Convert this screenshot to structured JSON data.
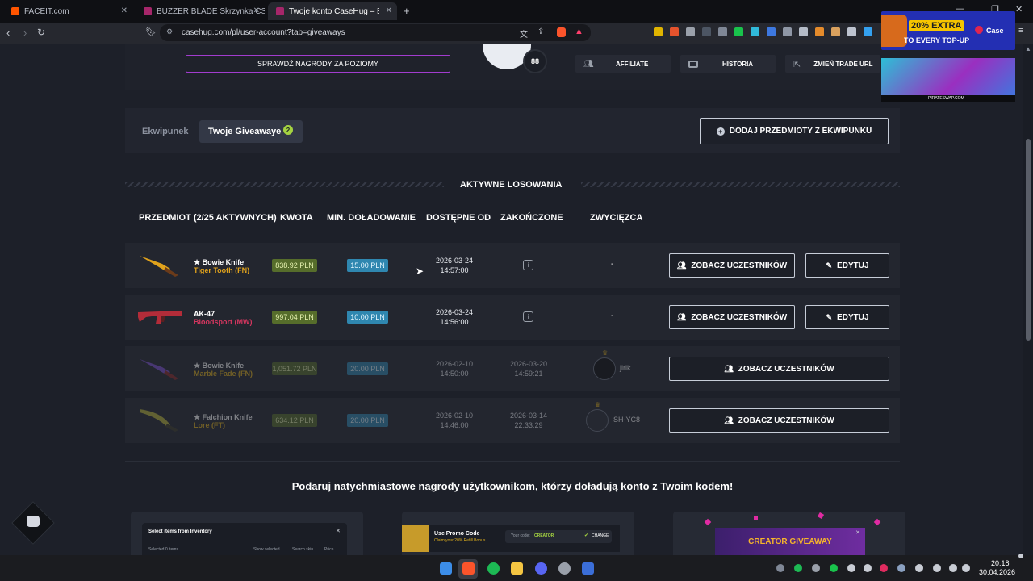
{
  "browser": {
    "tabs": [
      {
        "title": "FACEIT.com"
      },
      {
        "title": "BUZZER BLADE Skrzynka CS2 (CS:GO"
      },
      {
        "title": "Twoje konto CaseHug – Ekwipun"
      }
    ],
    "url": "casehug.com/pl/user-account?tab=giveaways"
  },
  "profile": {
    "levels_button": "SPRAWDŹ NAGRODY ZA POZIOMY",
    "level": "88",
    "actions": [
      {
        "label": "AFFILIATE",
        "icon": "users-icon"
      },
      {
        "label": "HISTORIA",
        "icon": "wallet-icon"
      },
      {
        "label": "ZMIEŃ TRADE URL",
        "icon": "external-link-icon"
      }
    ]
  },
  "ad": {
    "badge": "20% EXTRA",
    "subtitle": "TO EVERY TOP-UP",
    "brand": "Case",
    "site": "PIRATESWAP.COM"
  },
  "tabs": {
    "inventory": "Ekwipunek",
    "giveaways": "Twoje Giveawaye",
    "giveaways_count": "2",
    "add_items": "DODAJ PRZEDMIOTY Z EKWIPUNKU"
  },
  "section_title": "AKTYWNE LOSOWANIA",
  "table": {
    "headers": [
      "PRZEDMIOT (2/25 AKTYWNYCH)",
      "KWOTA",
      "MIN. DOŁADOWANIE",
      "DOSTĘPNE OD",
      "ZAKOŃCZONE",
      "ZWYCIĘZCA"
    ],
    "rows": [
      {
        "name": "★ Bowie Knife",
        "skin": "Tiger Tooth (FN)",
        "skin_color": "#e0a21c",
        "amount": "838.92 PLN",
        "min": "15.00 PLN",
        "from_date": "2026-03-24",
        "from_time": "14:57:00",
        "ended_date": "",
        "ended_time": "",
        "winner": "-",
        "view": "ZOBACZ UCZESTNIKÓW",
        "edit": "EDYTUJ",
        "active": true
      },
      {
        "name": "AK-47",
        "skin": "Bloodsport (MW)",
        "skin_color": "#d4365f",
        "amount": "997.04 PLN",
        "min": "10.00 PLN",
        "from_date": "2026-03-24",
        "from_time": "14:56:00",
        "ended_date": "",
        "ended_time": "",
        "winner": "-",
        "view": "ZOBACZ UCZESTNIKÓW",
        "edit": "EDYTUJ",
        "active": true
      },
      {
        "name": "★ Bowie Knife",
        "skin": "Marble Fade (FN)",
        "skin_color": "#e0b01c",
        "amount": "1,051.72 PLN",
        "min": "20.00 PLN",
        "from_date": "2026-02-10",
        "from_time": "14:50:00",
        "ended_date": "2026-03-20",
        "ended_time": "14:59:21",
        "winner": "jirik",
        "view": "ZOBACZ UCZESTNIKÓW",
        "edit": "",
        "active": false
      },
      {
        "name": "★ Falchion Knife",
        "skin": "Lore (FT)",
        "skin_color": "#e0b01c",
        "amount": "634.12 PLN",
        "min": "20.00 PLN",
        "from_date": "2026-02-10",
        "from_time": "14:46:00",
        "ended_date": "2026-03-14",
        "ended_time": "22:33:29",
        "winner": "SH-YC8",
        "view": "ZOBACZ UCZESTNIKÓW",
        "edit": "",
        "active": false
      }
    ]
  },
  "promo": {
    "title": "Podaruj natychmiastowe nagrody użytkownikom, którzy doładują konto z Twoim kodem!",
    "card1_title": "Select items from Inventory",
    "card1_row1": "Selected 0 items",
    "card1_row2": "Show selected",
    "card1_row3": "Search skin",
    "card1_row4": "Price",
    "card2_title": "Use Promo Code",
    "card2_sub": "Claim your 20% Refill Bonus",
    "card2_label": "Your code:",
    "card2_code": "CREATOR",
    "card2_btn": "CHANGE",
    "card3_title": "CREATOR GIVEAWAY"
  },
  "taskbar": {
    "time": "20:18",
    "date": "30.04.2026"
  }
}
